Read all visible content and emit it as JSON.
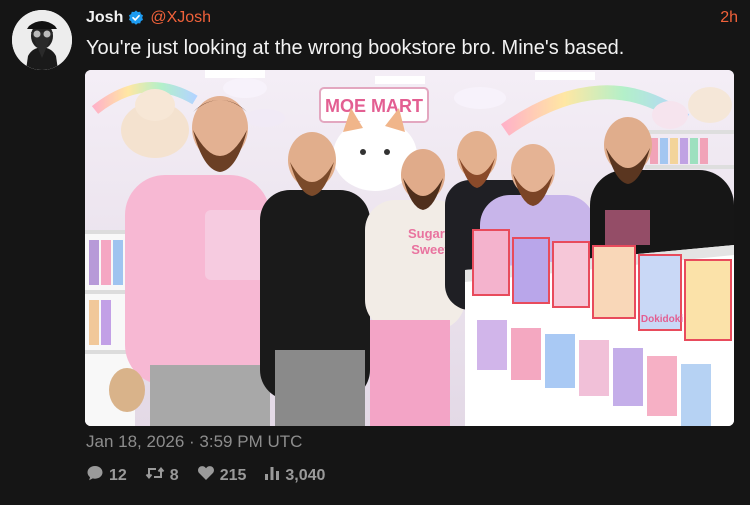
{
  "author": {
    "name": "Josh",
    "handle": "@XJosh",
    "time_ago": "2h"
  },
  "tweet": {
    "text": "You're just looking at the wrong bookstore bro. Mine's based.",
    "timestamp": "Jan 18, 2026 · 3:59 PM UTC"
  },
  "stats": {
    "replies": "12",
    "retweets": "8",
    "likes": "215",
    "views": "3,040"
  },
  "photo": {
    "store_sign": "MOE MART",
    "hoodie_text_1": "Sugary",
    "hoodie_text_2": "Sweet",
    "box_text": "Dokidoki"
  },
  "colors": {
    "accent": "#f0613a",
    "verified": "#1d9bf0",
    "background": "#151515",
    "muted": "#8d8d8d"
  },
  "icons": {
    "reply": "reply-icon",
    "retweet": "retweet-icon",
    "like": "heart-icon",
    "views": "views-icon",
    "verified": "verified-badge-icon"
  }
}
